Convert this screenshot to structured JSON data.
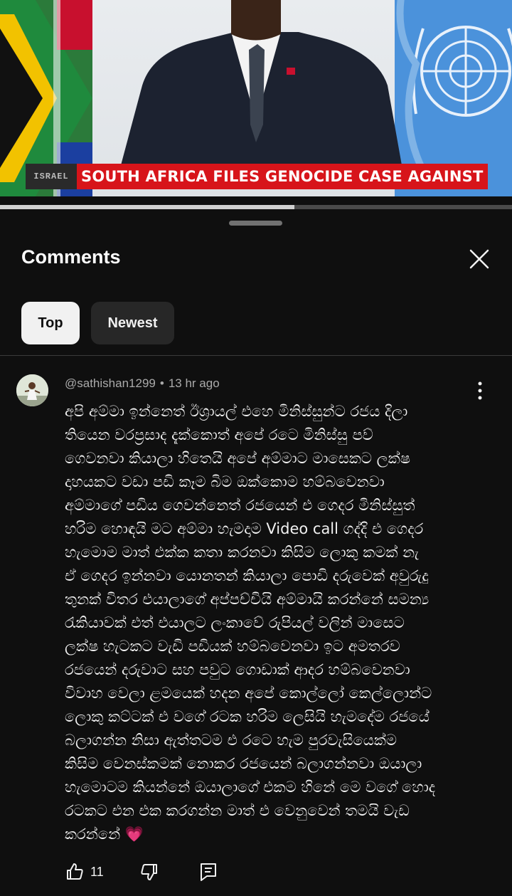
{
  "video": {
    "banner_logo": "ISRAEL",
    "banner_text": "SOUTH AFRICA FILES GENOCIDE CASE AGAINST ISRAEL",
    "progress_fraction": 0.575
  },
  "sheet": {
    "title": "Comments",
    "tabs": [
      {
        "label": "Top",
        "selected": true
      },
      {
        "label": "Newest",
        "selected": false
      }
    ]
  },
  "comment": {
    "author": "@sathishan1299",
    "separator": "•",
    "time": "13 hr ago",
    "lines": [
      "අපි අම්මා ඉන්නෙත් ඊශ්‍රායල් එහෙ මිනිස්සුන්ට රජය දිලා",
      "තියෙන වරප්‍රසාද දැක්කොත් අපේ රටෙ මිනිස්සු පව්",
      "ගෙවනවා කියාලා හිතෙයි අපේ අම්මාට මාසෙකට ලක්ෂ",
      "දාහයකට වඩා පඩි කෑම බිම ඔක්කොම හම්බවෙනවා",
      "අම්මාගේ පඩිය ගෙවන්නෙත් රජයෙන් එ ගෙදර මිනිස්සුත්",
      "හරිම හොඳයි මට අම්මා හැමදාම Video call ගද්දි එ ගෙදර",
      "හැමොම මාත් එක්ක කතා කරනවා කිසිම ලොකු කමක් නැ",
      "ඒ ගෙදර ඉන්නවා යොනතන් කියාලා පොඩි දරුවෙක් අවුරුදු",
      "තුනක් විතර එයාලාගේ අප්පච්චියි අම්මායි කරන්නේ සමන්‍ය",
      "රැකියාවක් එත් එයාලට ලංකාවේ රුපියල් වලින් මාසෙට",
      "ලක්ෂ හැටකට වැඩි පඩියක් හම්බවෙනවා ඉට අමතරව",
      "රජයෙන් දරුවාට සහ පවුට ගොඩාක් ආදර හම්බවෙනවා",
      "විවාහ වෙලා ළමයෙක් හදන අපේ කොල්ලෝ කෙල්ලොන්ට",
      "ලොකු කට්ටක් එ වගේ රටක හරිම ලෙසියි හැමදේම රජයේ",
      "බලාගන්න නිසා ඇත්තටම එ රටෙ හැම පුරවැසියෙක්ම",
      "කිසිම වෙනස්කමක් නොකර රජයෙන් බලාගන්නවා ඔයාලා",
      "හැමොටම කියන්නේ ඔයාලාගේ එකම හිනේ මෙ වගේ හොද",
      "රටකට එන එක කරගන්න මාත් එ වෙනුවෙන් තමයි වැඩ",
      "කරන්නේ"
    ],
    "emoji": "💗",
    "like_count": "11"
  },
  "icons": {
    "close": "close-icon",
    "more": "more-vertical-icon",
    "like": "thumbs-up-icon",
    "dislike": "thumbs-down-icon",
    "reply": "reply-icon"
  },
  "colors": {
    "background": "#0f0f0f",
    "banner_red": "#d7141a",
    "chip_selected": "#f1f1f1",
    "chip_unselected": "#272727",
    "secondary_text": "#aaaaaa"
  }
}
